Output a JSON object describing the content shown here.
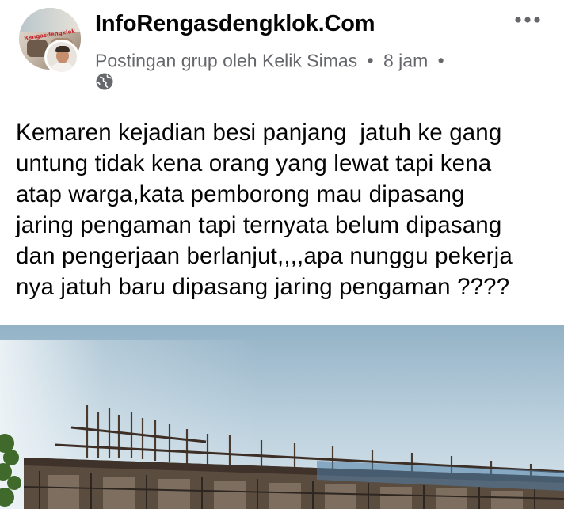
{
  "post": {
    "group_name": "InfoRengasdengklok.Com",
    "meta_prefix": "Postingan grup oleh",
    "author": "Kelik Simas",
    "separator": "•",
    "time": "8 jam",
    "privacy_icon": "globe-icon",
    "more_icon": "more-horizontal-icon",
    "text_lines": [
      "Kemaren kejadian besi panjang  jatuh ke gang",
      "untung tidak kena orang yang lewat tapi kena",
      "atap warga,kata pemborong mau dipasang",
      "jaring pengaman tapi ternyata belum dipasang",
      "dan pengerjaan berlanjut,,,,apa nunggu pekerja",
      "nya jatuh baru dipasang jaring pengaman ????"
    ],
    "avatar_tag": "Rengasdengklok"
  },
  "colors": {
    "text_primary": "#050505",
    "text_secondary": "#65676b",
    "sky_top": "#9ab6c8",
    "sky_bottom": "#d4e2ea"
  }
}
